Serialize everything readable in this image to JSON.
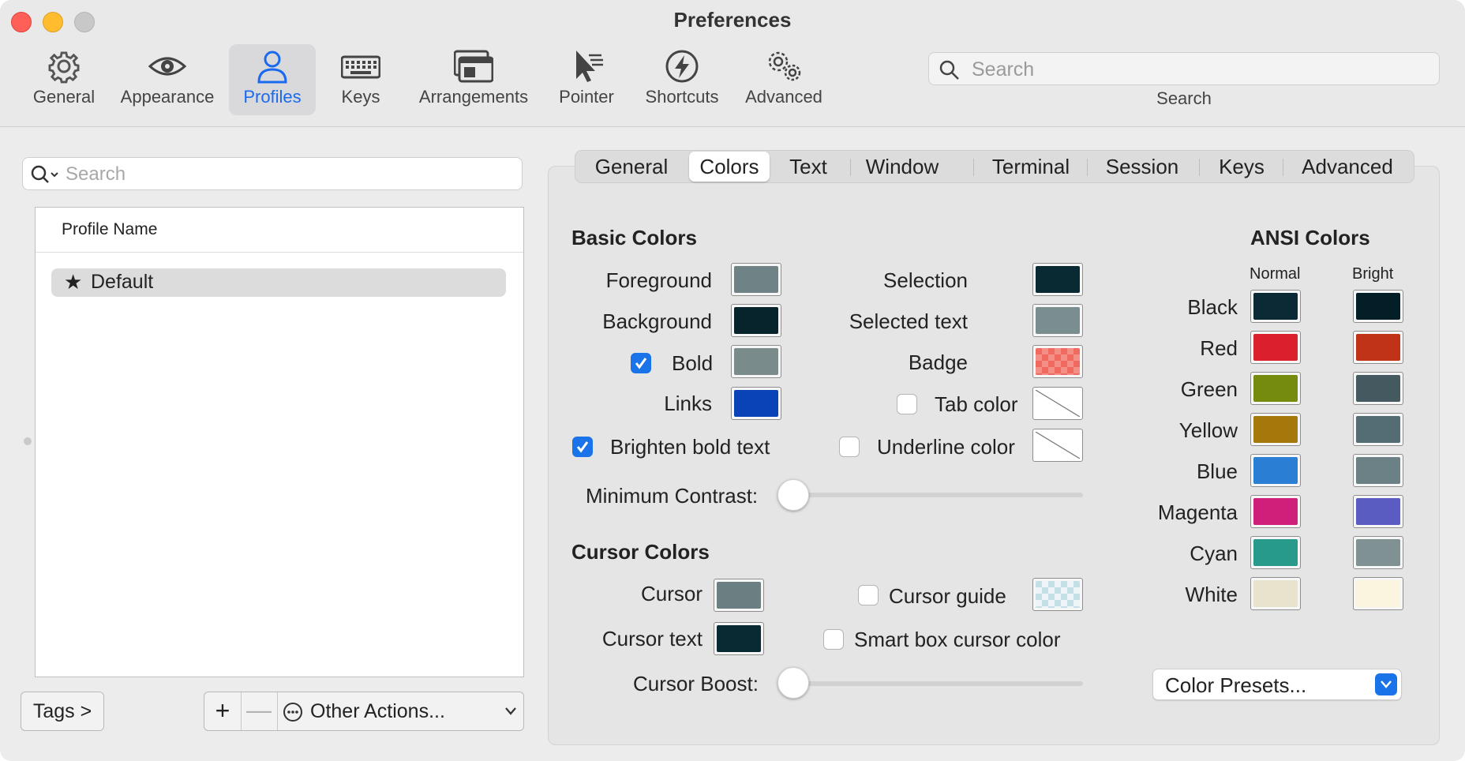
{
  "window": {
    "title": "Preferences"
  },
  "toolbar": {
    "items": [
      {
        "label": "General",
        "icon": "gear-icon"
      },
      {
        "label": "Appearance",
        "icon": "eye-icon"
      },
      {
        "label": "Profiles",
        "icon": "person-icon",
        "active": true
      },
      {
        "label": "Keys",
        "icon": "keyboard-icon"
      },
      {
        "label": "Arrangements",
        "icon": "windows-icon"
      },
      {
        "label": "Pointer",
        "icon": "pointer-icon"
      },
      {
        "label": "Shortcuts",
        "icon": "bolt-icon"
      },
      {
        "label": "Advanced",
        "icon": "gears-icon"
      }
    ],
    "search": {
      "placeholder": "Search",
      "label": "Search"
    }
  },
  "profiles": {
    "search_placeholder": "Search",
    "column_header": "Profile Name",
    "rows": [
      {
        "name": "Default",
        "default": true
      }
    ],
    "tags_button": "Tags >",
    "add_label": "+",
    "remove_label": "—",
    "other_actions": "Other Actions..."
  },
  "tabs": [
    "General",
    "Colors",
    "Text",
    "Window",
    "Terminal",
    "Session",
    "Keys",
    "Advanced"
  ],
  "active_tab": "Colors",
  "basic_colors": {
    "title": "Basic Colors",
    "foreground": {
      "label": "Foreground",
      "color": "#6f8387"
    },
    "background": {
      "label": "Background",
      "color": "#07232b"
    },
    "bold": {
      "label": "Bold",
      "checked": true,
      "color": "#7a8b8c"
    },
    "links": {
      "label": "Links",
      "color": "#0a43b8"
    },
    "selection": {
      "label": "Selection",
      "color": "#0a2a33"
    },
    "selected_text": {
      "label": "Selected text",
      "color": "#7b8e8f"
    },
    "badge": {
      "label": "Badge",
      "color": "#f06a5f"
    },
    "tab_color": {
      "label": "Tab color",
      "checked": false
    },
    "underline_color": {
      "label": "Underline color",
      "checked": false
    },
    "brighten_bold": {
      "label": "Brighten bold text",
      "checked": true
    },
    "min_contrast": {
      "label": "Minimum Contrast:",
      "value": 0
    }
  },
  "cursor_colors": {
    "title": "Cursor Colors",
    "cursor": {
      "label": "Cursor",
      "color": "#6b7f82"
    },
    "cursor_text": {
      "label": "Cursor text",
      "color": "#0a2a33"
    },
    "cursor_guide": {
      "label": "Cursor guide",
      "checked": false,
      "color": "#c4dfe6"
    },
    "smart_box": {
      "label": "Smart box cursor color",
      "checked": false
    },
    "cursor_boost": {
      "label": "Cursor Boost:",
      "value": 0
    }
  },
  "ansi": {
    "title": "ANSI Colors",
    "normal_label": "Normal",
    "bright_label": "Bright",
    "rows": [
      {
        "name": "Black",
        "normal": "#0b2a35",
        "bright": "#031e27"
      },
      {
        "name": "Red",
        "normal": "#dc1f2c",
        "bright": "#c03318"
      },
      {
        "name": "Green",
        "normal": "#748b0d",
        "bright": "#445960"
      },
      {
        "name": "Yellow",
        "normal": "#a4780a",
        "bright": "#546c73"
      },
      {
        "name": "Blue",
        "normal": "#2a7fd4",
        "bright": "#6b8185"
      },
      {
        "name": "Magenta",
        "normal": "#d01f7b",
        "bright": "#5b5cc1"
      },
      {
        "name": "Cyan",
        "normal": "#289a8c",
        "bright": "#7f9192"
      },
      {
        "name": "White",
        "normal": "#e8e3cc",
        "bright": "#fbf5e0"
      }
    ],
    "presets_label": "Color Presets..."
  }
}
